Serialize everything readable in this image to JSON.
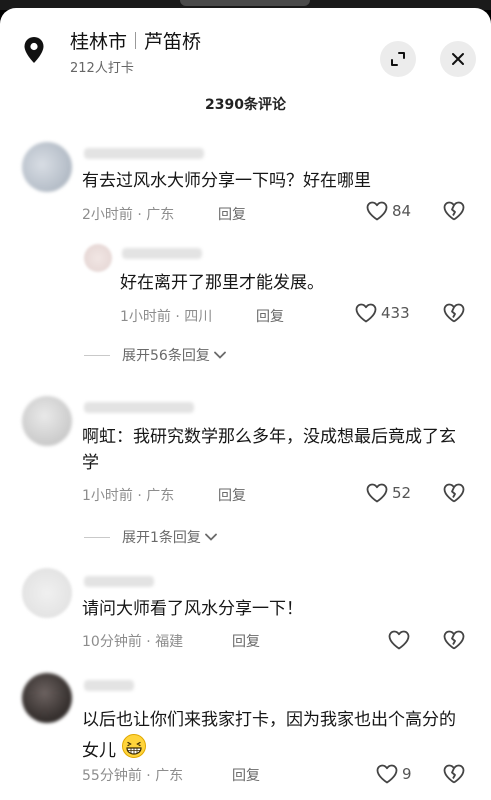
{
  "header": {
    "city": "桂林市",
    "spot": "芦笛桥",
    "checkins": "212人打卡",
    "comment_count": "2390条评论"
  },
  "comments": [
    {
      "text": "有去过风水大师分享一下吗？好在哪里",
      "time": "2小时前",
      "location": "广东",
      "reply": "回复",
      "likes": "84"
    },
    {
      "text": "好在离开了那里才能发展。",
      "time": "1小时前",
      "location": "四川",
      "reply": "回复",
      "likes": "433"
    },
    {
      "text": "啊虹：我研究数学那么多年，没成想最后竟成了玄学",
      "time": "1小时前",
      "location": "广东",
      "reply": "回复",
      "likes": "52"
    },
    {
      "text": "请问大师看了风水分享一下！",
      "time": "10分钟前",
      "location": "福建",
      "reply": "回复",
      "likes": ""
    },
    {
      "text": "以后也让你们来我家打卡，因为我家也出个高分的女儿",
      "time": "55分钟前",
      "location": "广东",
      "reply": "回复",
      "likes": "9"
    }
  ],
  "expand": {
    "first": "展开56条回复",
    "second": "展开1条回复"
  },
  "meta_separator": " · ",
  "icons": [
    "location-pin-icon",
    "expand-icon",
    "close-icon",
    "heart-icon",
    "broken-heart-icon",
    "chevron-down-icon",
    "grin-emoji-icon"
  ]
}
